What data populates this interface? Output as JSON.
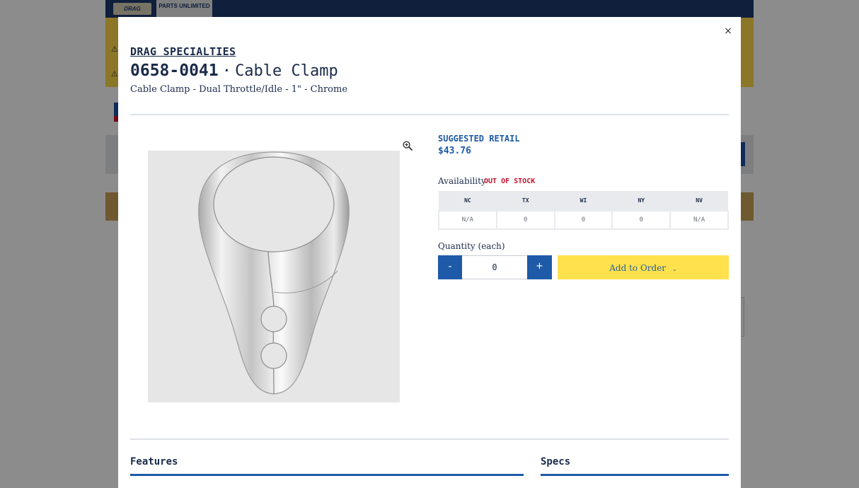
{
  "background": {
    "logos": {
      "drag": "DRAG",
      "parts_unlimited": "PARTS UNLIMITED"
    },
    "link": "es"
  },
  "modal": {
    "brand": "DRAG SPECIALTIES",
    "part_number": "0658-0041",
    "separator": "·",
    "part_name": "Cable Clamp",
    "subtitle": "Cable Clamp - Dual Throttle/Idle - 1\" - Chrome",
    "close_icon": "×",
    "zoom_icon": "zoom-in-icon"
  },
  "pricing": {
    "label": "SUGGESTED RETAIL",
    "price": "$43.76"
  },
  "availability": {
    "label": "Availability",
    "status": "OUT OF STOCK",
    "warehouses": [
      "NC",
      "TX",
      "WI",
      "NY",
      "NV"
    ],
    "quantities": [
      "N/A",
      "0",
      "0",
      "0",
      "N/A"
    ]
  },
  "quantity": {
    "label": "Quantity (each)",
    "minus": "-",
    "value": "0",
    "plus": "+"
  },
  "order": {
    "label": "Add to Order",
    "chevron": "⌄"
  },
  "sections": {
    "features": "Features",
    "specs": "Specs"
  },
  "colors": {
    "primary_blue": "#1e5aa8",
    "out_of_stock_red": "#c4122f",
    "add_to_order_yellow": "#ffe14d",
    "header_navy": "#1c3a6e"
  }
}
